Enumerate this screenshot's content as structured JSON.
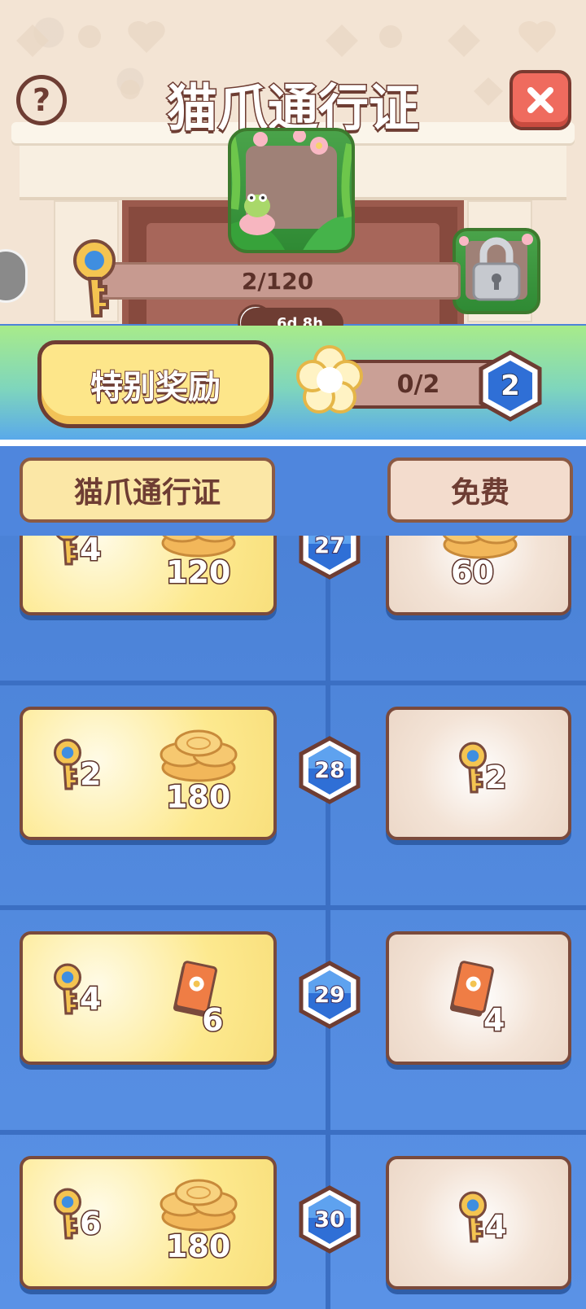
{
  "header": {
    "title": "猫爪通行证",
    "help_icon": "question-mark-icon",
    "close_icon": "close-x-icon",
    "progress": {
      "text": "2/120",
      "value": 2,
      "max": 120
    },
    "timer": "6d 8h",
    "locked_reward_icon": "padlock-icon"
  },
  "special": {
    "button_label": "特别奖励",
    "progress_text": "0/2",
    "badge_number": "2"
  },
  "columns": {
    "paid_label": "猫爪通行证",
    "free_label": "免费"
  },
  "rows": [
    {
      "level": "27",
      "paid": [
        {
          "icon": "key-icon",
          "qty": "4"
        },
        {
          "icon": "coins-icon",
          "qty": "120"
        }
      ],
      "free": [
        {
          "icon": "coins-icon",
          "qty": "60"
        }
      ]
    },
    {
      "level": "28",
      "paid": [
        {
          "icon": "key-icon",
          "qty": "2"
        },
        {
          "icon": "coins-icon",
          "qty": "180"
        }
      ],
      "free": [
        {
          "icon": "key-icon",
          "qty": "2"
        }
      ]
    },
    {
      "level": "29",
      "paid": [
        {
          "icon": "key-icon",
          "qty": "4"
        },
        {
          "icon": "card-pack-icon",
          "qty": "6"
        }
      ],
      "free": [
        {
          "icon": "card-pack-icon",
          "qty": "4"
        }
      ]
    },
    {
      "level": "30",
      "paid": [
        {
          "icon": "key-icon",
          "qty": "6"
        },
        {
          "icon": "coins-icon",
          "qty": "180"
        }
      ],
      "free": [
        {
          "icon": "key-icon",
          "qty": "4"
        }
      ]
    }
  ],
  "colors": {
    "brown": "#6e3d33",
    "blue": "#4d84d8",
    "yellow": "#fde68a",
    "close_red": "#ef6b5e"
  }
}
